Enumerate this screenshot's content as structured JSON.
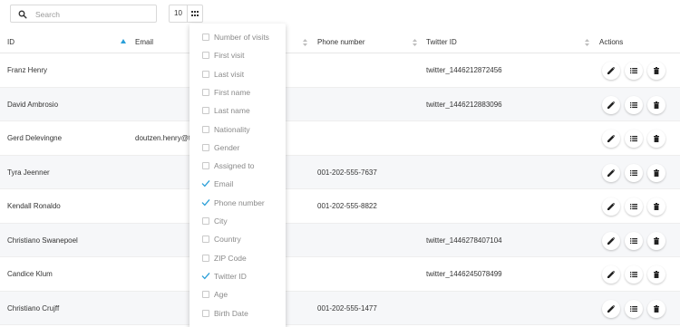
{
  "toolbar": {
    "search_placeholder": "Search",
    "search_value": "",
    "page_size": "10"
  },
  "columns": {
    "id": "ID",
    "email": "Email",
    "phone": "Phone number",
    "twitter": "Twitter ID",
    "actions": "Actions"
  },
  "rows": [
    {
      "id": "Franz Henry",
      "email": "",
      "phone": "",
      "twitter": "twitter_1446212872456"
    },
    {
      "id": "David Ambrosio",
      "email": "",
      "phone": "",
      "twitter": "twitter_1446212883096"
    },
    {
      "id": "Gerd Delevingne",
      "email": "doutzen.henry@to",
      "phone": "",
      "twitter": ""
    },
    {
      "id": "Tyra Jeenner",
      "email": "",
      "phone": "001-202-555-7637",
      "twitter": ""
    },
    {
      "id": "Kendall Ronaldo",
      "email": "",
      "phone": "001-202-555-8822",
      "twitter": ""
    },
    {
      "id": "Christiano Swanepoel",
      "email": "",
      "phone": "",
      "twitter": "twitter_1446278407104"
    },
    {
      "id": "Candice Klum",
      "email": "",
      "phone": "",
      "twitter": "twitter_1446245078499"
    },
    {
      "id": "Christiano Crujff",
      "email": "",
      "phone": "001-202-555-1477",
      "twitter": ""
    }
  ],
  "column_picker": [
    {
      "label": "Number of visits",
      "checked": false
    },
    {
      "label": "First visit",
      "checked": false
    },
    {
      "label": "Last visit",
      "checked": false
    },
    {
      "label": "First name",
      "checked": false
    },
    {
      "label": "Last name",
      "checked": false
    },
    {
      "label": "Nationality",
      "checked": false
    },
    {
      "label": "Gender",
      "checked": false
    },
    {
      "label": "Assigned to",
      "checked": false
    },
    {
      "label": "Email",
      "checked": true
    },
    {
      "label": "Phone number",
      "checked": true
    },
    {
      "label": "City",
      "checked": false
    },
    {
      "label": "Country",
      "checked": false
    },
    {
      "label": "ZIP Code",
      "checked": false
    },
    {
      "label": "Twitter ID",
      "checked": true
    },
    {
      "label": "Age",
      "checked": false
    },
    {
      "label": "Birth Date",
      "checked": false
    }
  ],
  "icons": {
    "search": "search-icon",
    "columns": "grid-icon",
    "edit": "pencil-icon",
    "details": "list-icon",
    "delete": "trash-icon",
    "sort": "sort-arrows-icon",
    "sort_active": "sort-ascending-icon",
    "check": "checkmark-icon"
  },
  "colors": {
    "accent": "#2a9fd8",
    "row_stripe": "#f6f7f9",
    "text": "#333333",
    "muted": "#8a8a8a"
  }
}
